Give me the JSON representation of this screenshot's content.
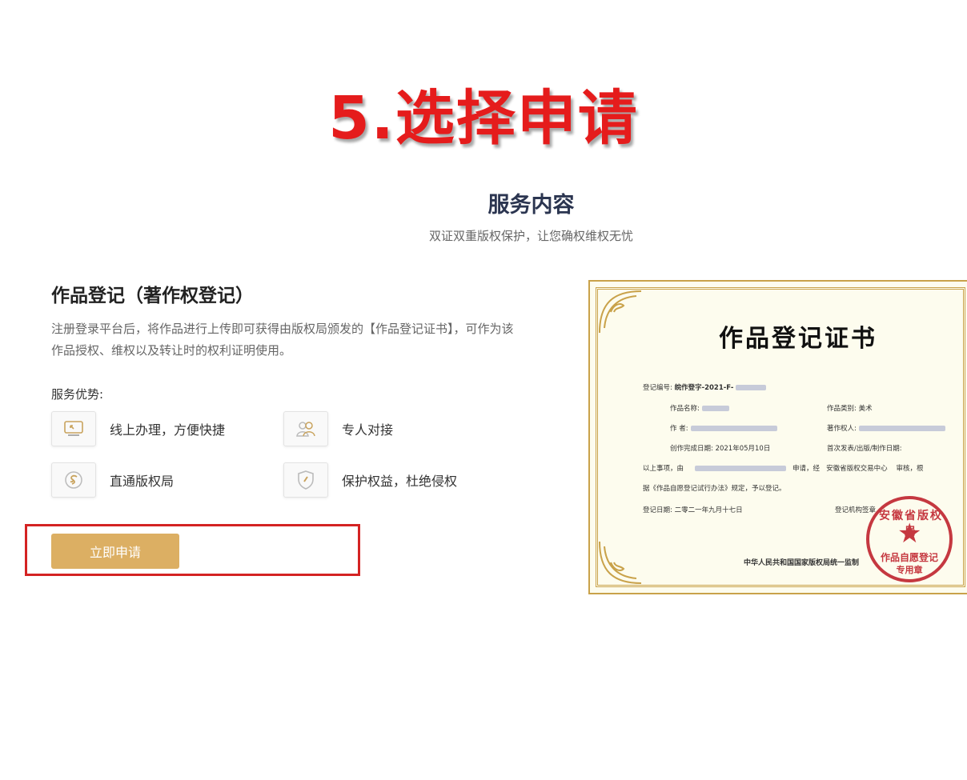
{
  "overlay": {
    "step_title": "5.选择申请"
  },
  "section": {
    "title": "服务内容",
    "subtitle": "双证双重版权保护，让您确权维权无忧"
  },
  "service": {
    "title": "作品登记（著作权登记）",
    "description": "注册登录平台后，将作品进行上传即可获得由版权局颁发的【作品登记证书】，可作为该作品授权、维权以及转让时的权利证明使用。",
    "advantages_label": "服务优势:",
    "advantages": [
      {
        "icon": "online-monitor-icon",
        "label": "线上办理，方便快捷"
      },
      {
        "icon": "personal-service-icon",
        "label": "专人对接"
      },
      {
        "icon": "copyright-bureau-icon",
        "label": "直通版权局"
      },
      {
        "icon": "shield-icon",
        "label": "保护权益，杜绝侵权"
      }
    ],
    "apply_button": "立即申请"
  },
  "certificate": {
    "title": "作品登记证书",
    "reg_no_label": "登记编号:",
    "reg_no_value": "皖作登字-2021-F-",
    "work_name_label": "作品名称:",
    "work_type_label": "作品类别:",
    "work_type_value": "美术",
    "author_label": "作 者:",
    "owner_label": "著作权人:",
    "complete_date_label": "创作完成日期:",
    "complete_date_value": "2021年05月10日",
    "publish_label": "首次发表/出版/制作日期:",
    "matter_prefix": "以上事项，由",
    "matter_mid": "申请，经",
    "matter_org": "安徽省版权交易中心",
    "matter_suffix": "审核，根",
    "matter_line2": "据《作品自愿登记试行办法》规定，予以登记。",
    "reg_date_label": "登记日期: 二零二一年九月十七日",
    "agency_sign_label": "登记机构签章",
    "footer": "中华人民共和国国家版权局统一监制",
    "seal_top": "安徽省版权局",
    "seal_mid": "作品自愿登记",
    "seal_bottom": "专用章"
  }
}
